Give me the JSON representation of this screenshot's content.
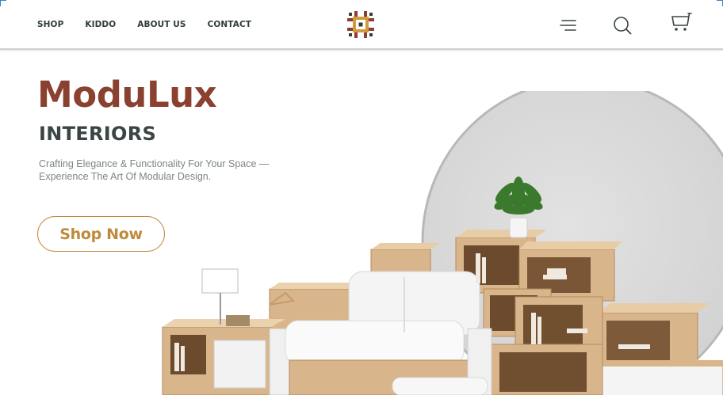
{
  "nav": {
    "items": [
      {
        "label": "SHOP"
      },
      {
        "label": "KIDDO"
      },
      {
        "label": "ABOUT US"
      },
      {
        "label": "CONTACT"
      }
    ]
  },
  "header": {
    "logo_icon": "geometric-brand-logo-icon",
    "menu_icon": "hamburger-menu-icon",
    "search_icon": "search-icon",
    "cart_icon": "cart-icon"
  },
  "hero": {
    "title": "ModuLux",
    "subtitle": "INTERIORS",
    "tagline_line1": "Crafting Elegance & Functionality For Your Space —",
    "tagline_line2": "Experience The Art Of Modular Design.",
    "cta_label": "Shop Now",
    "image": "modular-furniture-product-image"
  },
  "colors": {
    "brand_brown": "#8a4130",
    "heading_dark": "#3a4444",
    "accent_gold": "#c08a3c",
    "muted_text": "#7d8585",
    "wood": "#d9b58c",
    "circle_gray": "#d9d9d9"
  }
}
